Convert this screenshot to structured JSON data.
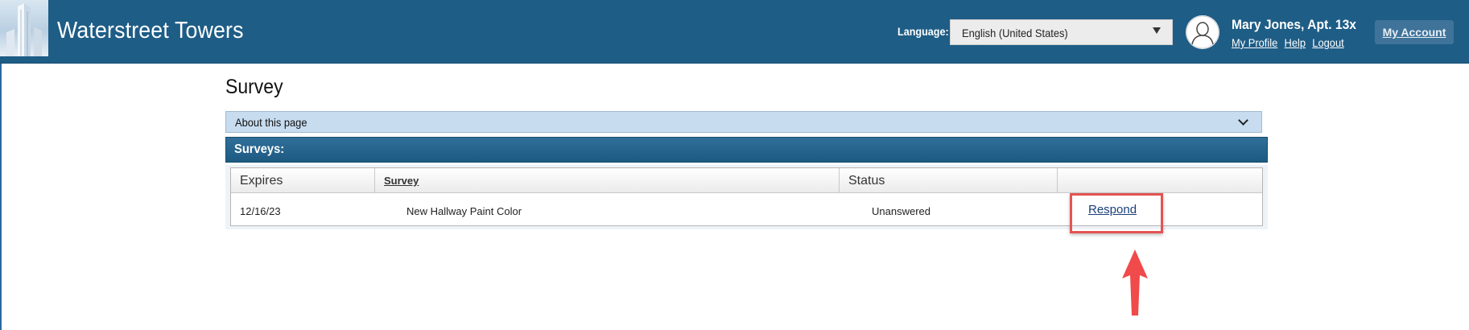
{
  "header": {
    "brand": "Waterstreet Towers",
    "language_label": "Language:",
    "language_value": "English (United States)",
    "user_name": "Mary Jones, Apt. 13x",
    "links": [
      "My Profile",
      "Help",
      "Logout"
    ],
    "my_account": "My Account"
  },
  "page": {
    "title": "Survey",
    "about_label": "About this page",
    "section_label": "Surveys:"
  },
  "table": {
    "columns": [
      "Expires",
      "Survey",
      "Status",
      ""
    ],
    "rows": [
      {
        "expires": "12/16/23",
        "survey": "New Hallway Paint Color",
        "status": "Unanswered",
        "action": "Respond"
      }
    ]
  },
  "colors": {
    "header_bg": "#1e5d86",
    "about_bg": "#c7dcef",
    "highlight": "#e45353"
  }
}
